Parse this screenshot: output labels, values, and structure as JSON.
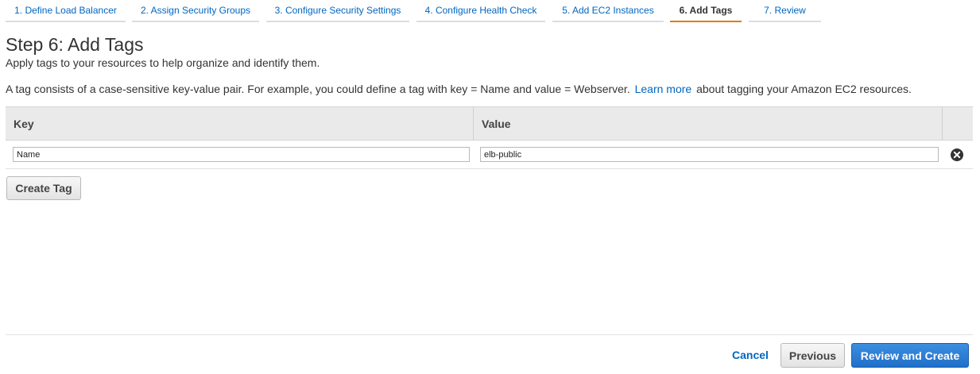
{
  "wizard": {
    "steps": [
      {
        "label": "1. Define Load Balancer"
      },
      {
        "label": "2. Assign Security Groups"
      },
      {
        "label": "3. Configure Security Settings"
      },
      {
        "label": "4. Configure Health Check"
      },
      {
        "label": "5. Add EC2 Instances"
      },
      {
        "label": "6. Add Tags",
        "active": true
      },
      {
        "label": "7. Review"
      }
    ]
  },
  "page": {
    "title": "Step 6: Add Tags",
    "subtitle": "Apply tags to your resources to help organize and identify them.",
    "info_prefix": "A tag consists of a case-sensitive key-value pair. For example, you could define a tag with key = Name and value = Webserver.",
    "learn_more": "Learn more",
    "info_suffix": "about tagging your Amazon EC2 resources."
  },
  "table": {
    "headers": {
      "key": "Key",
      "value": "Value"
    },
    "rows": [
      {
        "key": "Name",
        "value": "elb-public"
      }
    ]
  },
  "icons": {
    "remove": "remove-circle-x-icon"
  },
  "buttons": {
    "create_tag": "Create Tag",
    "cancel": "Cancel",
    "previous": "Previous",
    "review_and_create": "Review and Create"
  },
  "colors": {
    "link": "#0066c0",
    "active_tab_underline": "#e47911",
    "primary_button": "#1f6fc9"
  }
}
